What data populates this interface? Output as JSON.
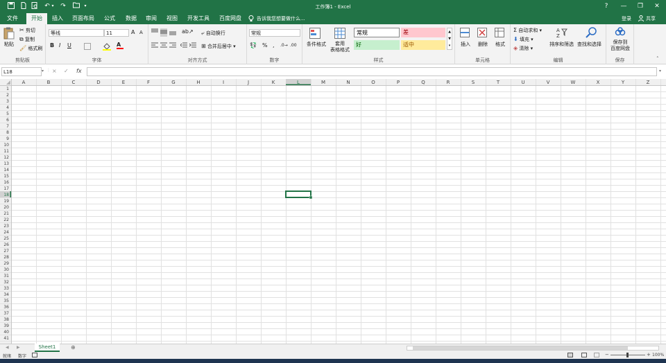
{
  "window": {
    "title": "工作簿1 - Excel",
    "help_glyph": "?",
    "minimize_glyph": "—",
    "restore_glyph": "❐",
    "close_glyph": "✕"
  },
  "quick_access": {
    "customize_glyph": "▾"
  },
  "tabs": [
    {
      "label": "文件",
      "active": false
    },
    {
      "label": "开始",
      "active": true
    },
    {
      "label": "插入",
      "active": false
    },
    {
      "label": "页面布局",
      "active": false
    },
    {
      "label": "公式",
      "active": false
    },
    {
      "label": "数据",
      "active": false
    },
    {
      "label": "审阅",
      "active": false
    },
    {
      "label": "视图",
      "active": false
    },
    {
      "label": "开发工具",
      "active": false
    },
    {
      "label": "百度网盘",
      "active": false
    }
  ],
  "tell_me": {
    "placeholder": "告诉我您想要做什么..."
  },
  "account": {
    "login": "登录",
    "share": "共享"
  },
  "ribbon": {
    "clipboard": {
      "label": "剪贴板",
      "paste": "粘贴",
      "cut": "剪切",
      "copy": "复制",
      "format_painter": "格式刷"
    },
    "font": {
      "label": "字体",
      "font_name": "等线",
      "font_size": "11",
      "bold": "B",
      "italic": "I",
      "underline": "U",
      "grow": "A",
      "shrink": "A"
    },
    "alignment": {
      "label": "对齐方式",
      "wrap_text": "自动换行",
      "merge_center": "合并后居中"
    },
    "number": {
      "label": "数字",
      "format": "常规",
      "percent": "%",
      "comma": ","
    },
    "styles": {
      "label": "样式",
      "conditional": "条件格式",
      "table": "套用\n表格格式",
      "cells": [
        {
          "text": "常规",
          "bg": "#ffffff",
          "color": "#000000"
        },
        {
          "text": "差",
          "bg": "#ffc7ce",
          "color": "#9c0006"
        },
        {
          "text": "好",
          "bg": "#c6efce",
          "color": "#006100"
        },
        {
          "text": "适中",
          "bg": "#ffeb9c",
          "color": "#9c5700"
        }
      ]
    },
    "cells": {
      "label": "单元格",
      "insert": "插入",
      "delete": "删除",
      "format": "格式"
    },
    "editing": {
      "label": "编辑",
      "autosum": "自动求和",
      "fill": "填充",
      "clear": "清除",
      "sort": "排序和筛选",
      "find": "查找和选择"
    },
    "save": {
      "label": "保存",
      "save_to": "保存到\n百度网盘"
    }
  },
  "formula_bar": {
    "name_box": "L18",
    "cancel": "×",
    "enter": "✓",
    "fx": "fx",
    "value": ""
  },
  "grid": {
    "columns": [
      "A",
      "B",
      "C",
      "D",
      "E",
      "F",
      "G",
      "H",
      "I",
      "J",
      "K",
      "L",
      "M",
      "N",
      "O",
      "P",
      "Q",
      "R",
      "S",
      "T",
      "U",
      "V",
      "W",
      "X",
      "Y",
      "Z"
    ],
    "row_count": 41,
    "selected_cell": "L18",
    "selected_column": "L",
    "selected_row": 18
  },
  "sheets": [
    {
      "label": "Sheet1",
      "active": true
    }
  ],
  "add_sheet": "⊕",
  "status": {
    "ready": "就绪",
    "mode": "数字",
    "zoom": "100%"
  },
  "colors": {
    "accent": "#217346",
    "selection": "#217346",
    "header_bg": "#f0f0f0",
    "grid_line": "#e1e1e1"
  }
}
